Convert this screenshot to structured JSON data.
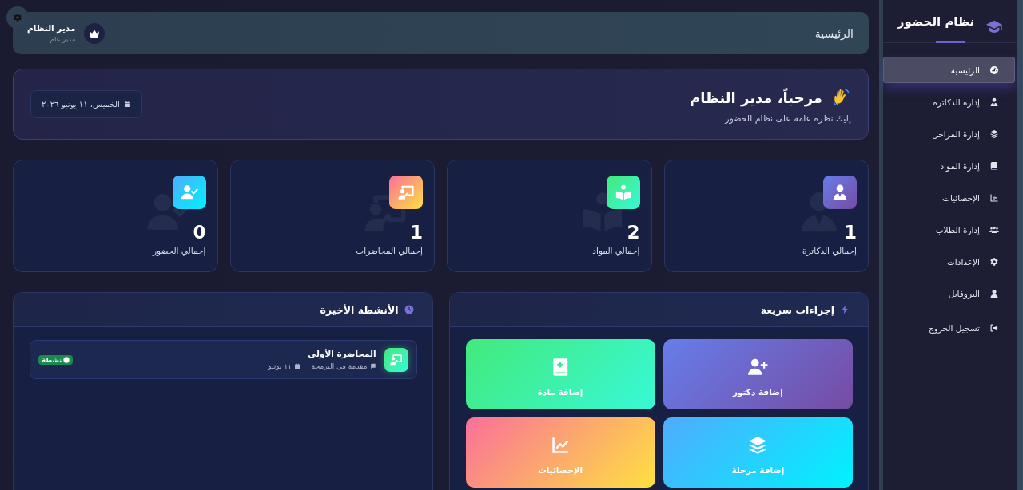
{
  "sidebar": {
    "title": "نظام الحضور",
    "items": [
      {
        "kind": "dashboard",
        "label": "الرئيسية",
        "selected": true
      },
      {
        "kind": "doctors",
        "label": "إدارة الدكاترة",
        "selected": false
      },
      {
        "kind": "stages",
        "label": "إدارة المراحل",
        "selected": false
      },
      {
        "kind": "subjects",
        "label": "إدارة المواد",
        "selected": false
      },
      {
        "kind": "statistics",
        "label": "الإحصائيات",
        "selected": false
      },
      {
        "kind": "students",
        "label": "إدارة الطلاب",
        "selected": false
      },
      {
        "kind": "settings",
        "label": "الإعدادات",
        "selected": false
      },
      {
        "kind": "profile",
        "label": "البروفايل",
        "selected": false
      }
    ],
    "logout": {
      "label": "تسجيل الخروج"
    }
  },
  "header": {
    "title": "الرئيسية",
    "user": {
      "name": "مدير النظام",
      "role": "مدير عام"
    }
  },
  "welcome": {
    "title": "مرحباً، مدير النظام",
    "subtitle": "إليك نظرة عامة على نظام الحضور",
    "date": "الخميس، ١١ يونيو ٢٠٢٦"
  },
  "stats": [
    {
      "kind": "doctors",
      "value": "1",
      "label": "إجمالي الدكاترة"
    },
    {
      "kind": "subjects",
      "value": "2",
      "label": "إجمالي المواد"
    },
    {
      "kind": "lectures",
      "value": "1",
      "label": "إجمالي المحاضرات"
    },
    {
      "kind": "attendance",
      "value": "0",
      "label": "إجمالي الحضور"
    }
  ],
  "quick_actions": {
    "title": "إجراءات سريعة",
    "actions": [
      {
        "kind": "doctor",
        "label": "إضافة دكتور"
      },
      {
        "kind": "subject",
        "label": "إضافة مادة"
      },
      {
        "kind": "stage",
        "label": "إضافة مرحلة"
      },
      {
        "kind": "statistics",
        "label": "الإحصائيات"
      }
    ]
  },
  "recent_activities": {
    "title": "الأنشطة الأخيرة",
    "items": [
      {
        "kind": "lecture",
        "title": "المحاضرة الأولى",
        "subject": "مقدمة في البرمجة",
        "date": "١١ يونيو",
        "status": "نشطة",
        "active": true
      }
    ]
  }
}
